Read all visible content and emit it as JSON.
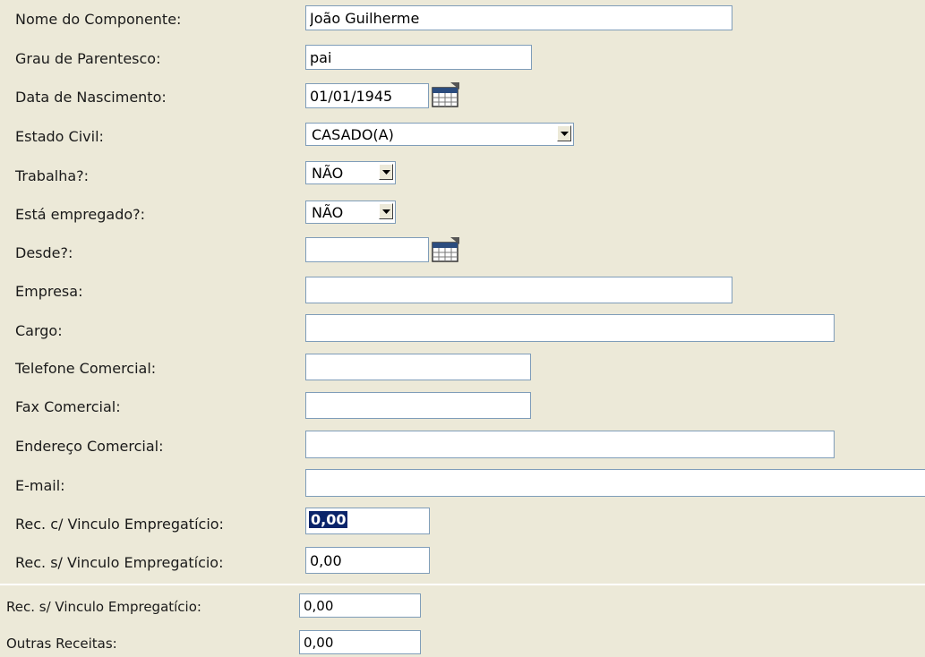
{
  "fields": {
    "nome_componente": {
      "label": "Nome do Componente:",
      "value": "João Guilherme"
    },
    "grau_parentesco": {
      "label": "Grau de Parentesco:",
      "value": "pai"
    },
    "data_nascimento": {
      "label": "Data de Nascimento:",
      "value": "01/01/1945"
    },
    "estado_civil": {
      "label": "Estado Civil:",
      "value": "CASADO(A)"
    },
    "trabalha": {
      "label": "Trabalha?:",
      "value": "NÃO"
    },
    "esta_empregado": {
      "label": "Está empregado?:",
      "value": "NÃO"
    },
    "desde": {
      "label": "Desde?:",
      "value": ""
    },
    "empresa": {
      "label": "Empresa:",
      "value": ""
    },
    "cargo": {
      "label": "Cargo:",
      "value": ""
    },
    "telefone_comercial": {
      "label": "Telefone Comercial:",
      "value": ""
    },
    "fax_comercial": {
      "label": "Fax Comercial:",
      "value": ""
    },
    "endereco_comercial": {
      "label": "Endereço Comercial:",
      "value": ""
    },
    "email": {
      "label": "E-mail:",
      "value": ""
    },
    "rec_com_vinculo": {
      "label": "Rec. c/ Vinculo Empregatício:",
      "value": "0,00"
    },
    "rec_sem_vinculo": {
      "label": "Rec. s/ Vinculo Empregatício:",
      "value": "0,00"
    }
  },
  "lower_panel": {
    "rec_sem_vinculo": {
      "label": "Rec. s/ Vinculo Empregatício:",
      "value": "0,00"
    },
    "outras_receitas": {
      "label": "Outras Receitas:",
      "value": "0,00"
    }
  },
  "icons": {
    "calendar": "calendar-icon",
    "dropdown": "chevron-down-icon"
  }
}
